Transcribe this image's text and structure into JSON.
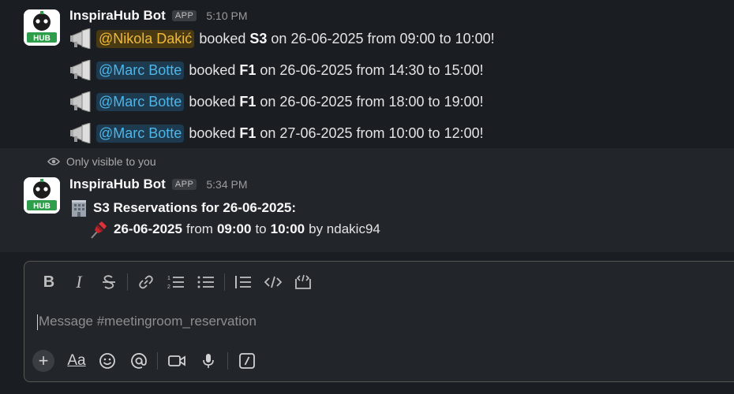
{
  "group1": {
    "bot_name": "InspiraHub Bot",
    "app_badge": "APP",
    "time": "5:10 PM",
    "avatar_text": "HUB",
    "messages": [
      {
        "mention": "@Nikola Dakić",
        "verb": "booked",
        "room": "S3",
        "on": "on",
        "date": "26-06-2025",
        "from": "from",
        "start": "09:00",
        "to": "to",
        "end": "10:00!",
        "self": true
      },
      {
        "mention": "@Marc Botte",
        "verb": "booked",
        "room": "F1",
        "on": "on",
        "date": "26-06-2025",
        "from": "from",
        "start": "14:30",
        "to": "to",
        "end": "15:00!",
        "self": false
      },
      {
        "mention": "@Marc Botte",
        "verb": "booked",
        "room": "F1",
        "on": "on",
        "date": "26-06-2025",
        "from": "from",
        "start": "18:00",
        "to": "to",
        "end": "19:00!",
        "self": false
      },
      {
        "mention": "@Marc Botte",
        "verb": "booked",
        "room": "F1",
        "on": "on",
        "date": "27-06-2025",
        "from": "from",
        "start": "10:00",
        "to": "to",
        "end": "12:00!",
        "self": false
      }
    ]
  },
  "visibility_note": "Only visible to you",
  "group2": {
    "bot_name": "InspiraHub Bot",
    "app_badge": "APP",
    "time": "5:34 PM",
    "avatar_text": "HUB",
    "title": "S3 Reservations for 26-06-2025:",
    "reservation": {
      "date": "26-06-2025",
      "from": "from",
      "start": "09:00",
      "to": "to",
      "end": "10:00",
      "by": "by ndakic94"
    }
  },
  "composer": {
    "placeholder": "Message #meetingroom_reservation",
    "toolbar_icons": [
      "bold-icon",
      "italic-icon",
      "strikethrough-icon",
      "link-icon",
      "numbered-list-icon",
      "bulleted-list-icon",
      "blockquote-icon",
      "code-icon",
      "code-block-icon"
    ],
    "bottom_icons": [
      "plus-icon",
      "formatting-icon",
      "emoji-icon",
      "mention-icon",
      "video-icon",
      "microphone-icon",
      "slash-command-icon"
    ],
    "labels": {
      "bold": "B",
      "italic": "I",
      "formatting": "Aa"
    }
  },
  "colors": {
    "background": "#1a1d21",
    "mention_self_bg": "#4a3a14",
    "mention_self_fg": "#f0b93a",
    "mention_other_bg": "#1d3a4f",
    "mention_other_fg": "#4fb5e8",
    "avatar_green": "#2e9e4a"
  }
}
